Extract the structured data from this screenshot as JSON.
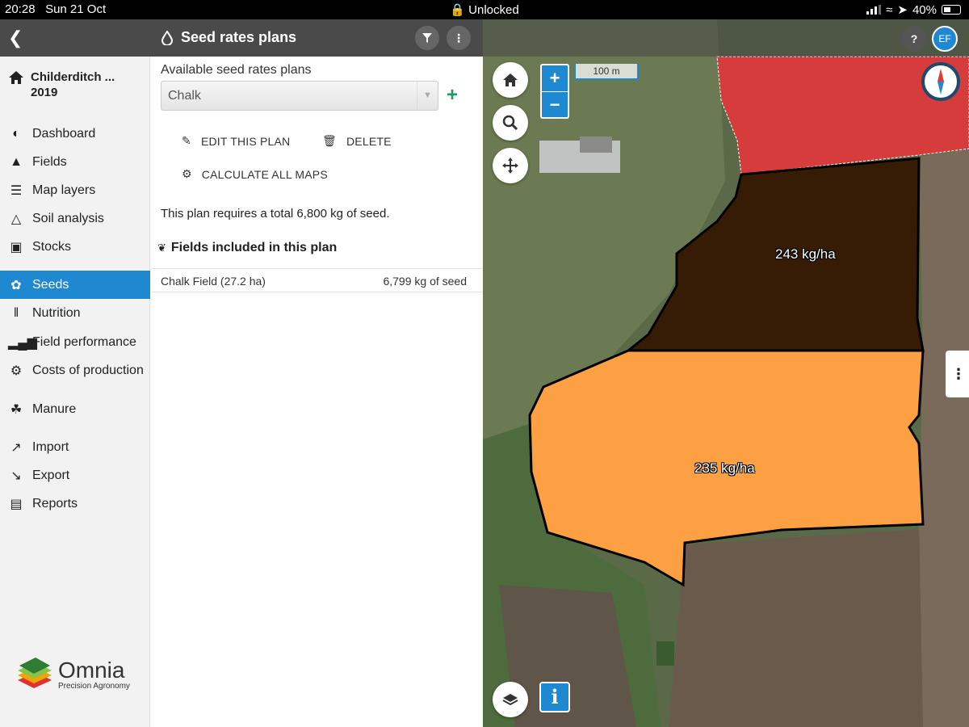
{
  "status_bar": {
    "time": "20:28",
    "date": "Sun 21 Oct",
    "lock_status": "Unlocked",
    "battery": "40%"
  },
  "header": {
    "title": "Seed rates plans"
  },
  "sidebar": {
    "farm_name": "Childerditch ...",
    "farm_year": "2019",
    "items": [
      {
        "label": "Dashboard",
        "icon": "gauge-icon"
      },
      {
        "label": "Fields",
        "icon": "fields-icon"
      },
      {
        "label": "Map layers",
        "icon": "layers-icon"
      },
      {
        "label": "Soil analysis",
        "icon": "flask-icon"
      },
      {
        "label": "Stocks",
        "icon": "box-icon"
      },
      {
        "label": "Seeds",
        "icon": "seed-icon",
        "active": true
      },
      {
        "label": "Nutrition",
        "icon": "utensils-icon"
      },
      {
        "label": "Field performance",
        "icon": "bar-chart-icon"
      },
      {
        "label": "Costs of production",
        "icon": "gear-coin-icon"
      },
      {
        "label": "Manure",
        "icon": "sprout-icon"
      },
      {
        "label": "Import",
        "icon": "import-arrow-icon"
      },
      {
        "label": "Export",
        "icon": "export-arrow-icon"
      },
      {
        "label": "Reports",
        "icon": "reports-icon"
      }
    ],
    "logo": {
      "brand": "Omnia",
      "tagline": "Precision Agronomy"
    }
  },
  "panel": {
    "plans_label": "Available seed rates plans",
    "selected_plan": "Chalk",
    "edit_label": "EDIT THIS PLAN",
    "delete_label": "DELETE",
    "calculate_label": "CALCULATE ALL MAPS",
    "summary": "This plan requires a total 6,800 kg of seed.",
    "fields_heading": "Fields included in this plan",
    "fields": [
      {
        "name": "Chalk Field (27.2 ha)",
        "seed": "6,799 kg of seed"
      }
    ]
  },
  "map": {
    "user_initials": "EF",
    "help_label": "?",
    "scale": "100 m",
    "zoom_in": "+",
    "zoom_out": "−",
    "info_label": "i",
    "zones": [
      {
        "label": "243 kg/ha",
        "color": "#361c05"
      },
      {
        "label": "235 kg/ha",
        "color": "#fca043"
      }
    ],
    "neighbor_color": "#d73c3c"
  }
}
